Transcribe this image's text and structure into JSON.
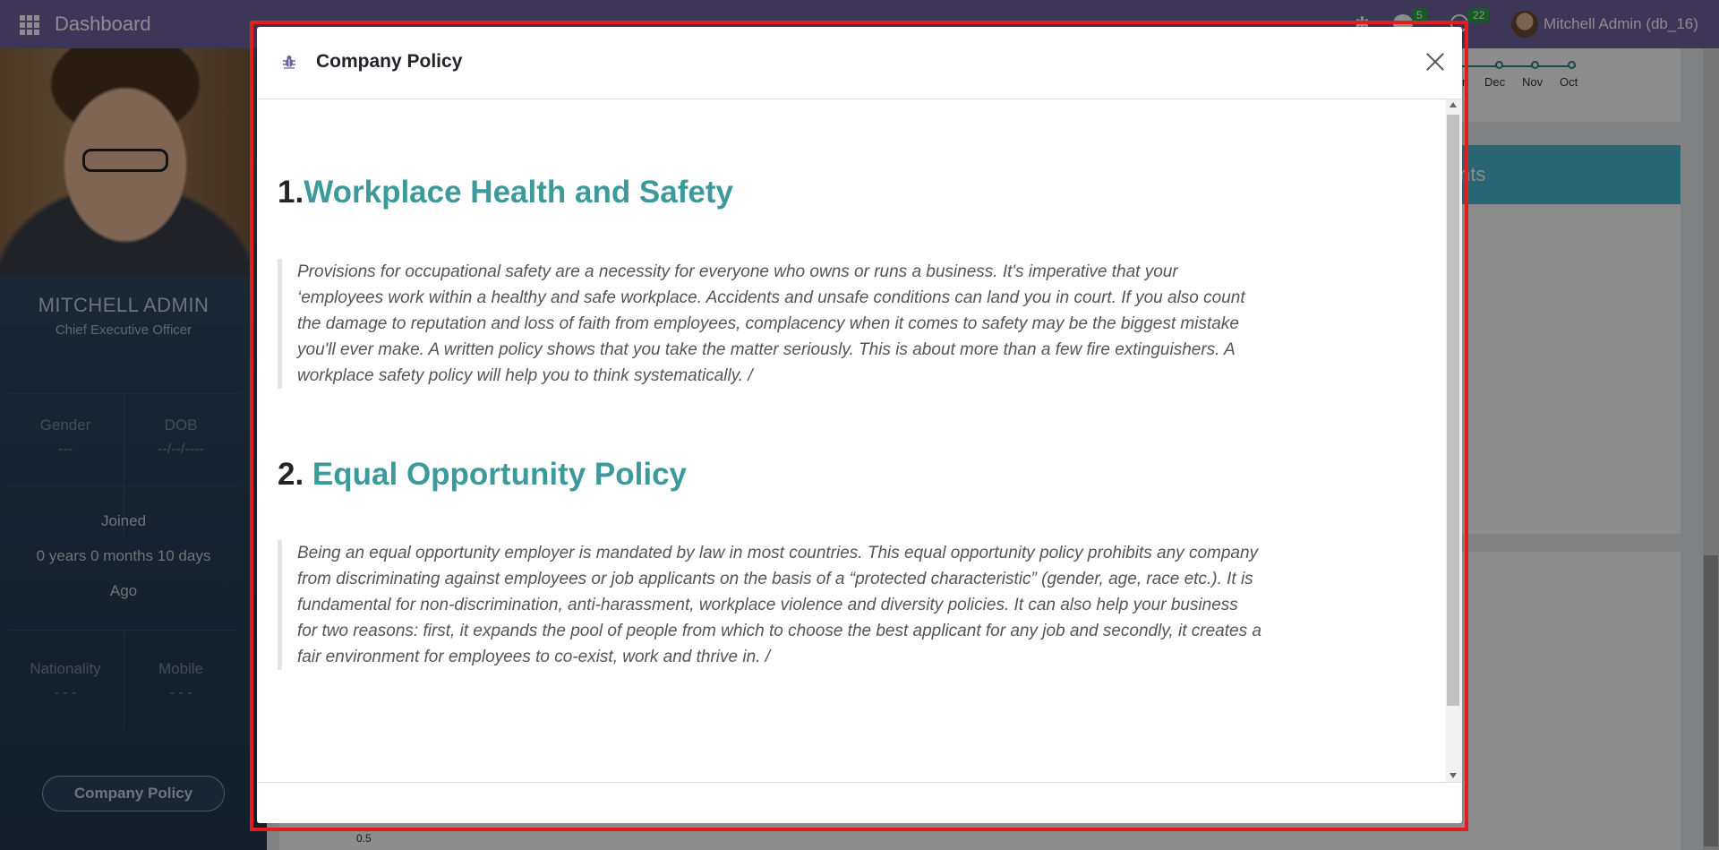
{
  "navbar": {
    "brand": "Dashboard",
    "messages_count": "5",
    "activities_count": "22",
    "user": "Mitchell Admin (db_16)"
  },
  "employee": {
    "name": "MITCHELL ADMIN",
    "job_title": "Chief Executive Officer",
    "gender_label": "Gender",
    "gender_value": "---",
    "dob_label": "DOB",
    "dob_value": "--/--/----",
    "joined_label": "Joined",
    "joined_value": "0 years 0 months 10 days",
    "joined_suffix": "Ago",
    "nationality_label": "Nationality",
    "nationality_value": "- - -",
    "mobile_label": "Mobile",
    "mobile_value": "- - -",
    "policy_button": "Company Policy"
  },
  "background": {
    "timeline_months": [
      "Dec",
      "Nov",
      "Oct"
    ],
    "timeline_partial": "r",
    "banner_text": "nts",
    "chart_tick": "0.5"
  },
  "modal": {
    "title": "Company Policy",
    "sections": [
      {
        "number": "1.",
        "title": "Workplace Health and Safety",
        "text": "Provisions for occupational safety are a necessity for everyone who owns or runs a business. It's imperative that your ‘employees work within a healthy and safe workplace. Accidents and unsafe conditions can land you in court. If you also count the damage to reputation and loss of faith from employees, complacency when it comes to safety may be the biggest mistake you'll ever make. A written policy shows that you take the matter seriously. This is about more than a few fire extinguishers. A workplace safety policy will help you to think systematically. /"
      },
      {
        "number": "2. ",
        "title": "Equal Opportunity Policy",
        "text": "Being an equal opportunity employer is mandated by law in most countries. This equal opportunity policy prohibits any company from discriminating against employees or job applicants on the basis of a “protected characteristic” (gender, age, race etc.). It is fundamental for non-discrimination, anti-harassment, workplace violence and diversity policies. It can also help your business for two reasons: first, it expands the pool of people from which to choose the best applicant for any job and secondly, it creates a fair environment for employees to co-exist, work and thrive in. /"
      }
    ]
  }
}
